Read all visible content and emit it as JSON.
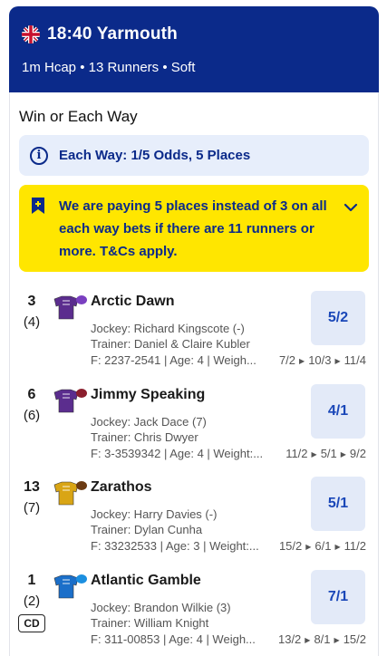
{
  "race": {
    "title": "18:40 Yarmouth",
    "subtitle": "1m Hcap • 13 Runners • Soft"
  },
  "market": {
    "title": "Win or Each Way"
  },
  "each_way": {
    "text": "Each Way: 1/5 Odds, 5 Places"
  },
  "promo": {
    "text": "We are paying 5 places instead of 3 on all each way bets if there are 11 runners or more. T&Cs apply."
  },
  "runners": [
    {
      "number": "3",
      "draw": "(4)",
      "name": "Arctic Dawn",
      "jockey": "Jockey: Richard Kingscote (-)",
      "trainer": "Trainer: Daniel & Claire Kubler",
      "form": "F: 2237-2541 | Age: 4 | Weigh...",
      "prices": [
        "7/2",
        "10/3",
        "11/4"
      ],
      "odds": "5/2",
      "silk": {
        "body": "#5b2d8e",
        "cap": "#7a3fc0"
      }
    },
    {
      "number": "6",
      "draw": "(6)",
      "name": "Jimmy Speaking",
      "jockey": "Jockey: Jack Dace (7)",
      "trainer": "Trainer: Chris Dwyer",
      "form": "F: 3-3539342 | Age: 4 | Weight:...",
      "prices": [
        "11/2",
        "5/1",
        "9/2"
      ],
      "odds": "4/1",
      "silk": {
        "body": "#5b2d8e",
        "cap": "#8b1e2d"
      }
    },
    {
      "number": "13",
      "draw": "(7)",
      "name": "Zarathos",
      "jockey": "Jockey: Harry Davies (-)",
      "trainer": "Trainer: Dylan Cunha",
      "form": "F: 33232533 | Age: 3 | Weight:...",
      "prices": [
        "15/2",
        "6/1",
        "11/2"
      ],
      "odds": "5/1",
      "silk": {
        "body": "#d9a515",
        "cap": "#6b3a12"
      }
    },
    {
      "number": "1",
      "draw": "(2)",
      "badge": "CD",
      "name": "Atlantic Gamble",
      "jockey": "Jockey: Brandon Wilkie (3)",
      "trainer": "Trainer: William Knight",
      "form": "F: 311-00853 | Age: 4 | Weigh...",
      "prices": [
        "13/2",
        "8/1",
        "15/2"
      ],
      "odds": "7/1",
      "silk": {
        "body": "#1b6fc9",
        "cap": "#1b8fe0"
      }
    }
  ],
  "colors": {
    "header_bg": "#0b2a8a",
    "promo_bg": "#ffe600",
    "info_bg": "#e7eefb",
    "odds_bg": "#e3eaf8",
    "odds_text": "#1a47b8"
  },
  "icons": {
    "flag": "uk-flag-icon",
    "info": "info-icon",
    "promo": "bookmark-plus-icon",
    "expand": "chevron-down-icon"
  }
}
